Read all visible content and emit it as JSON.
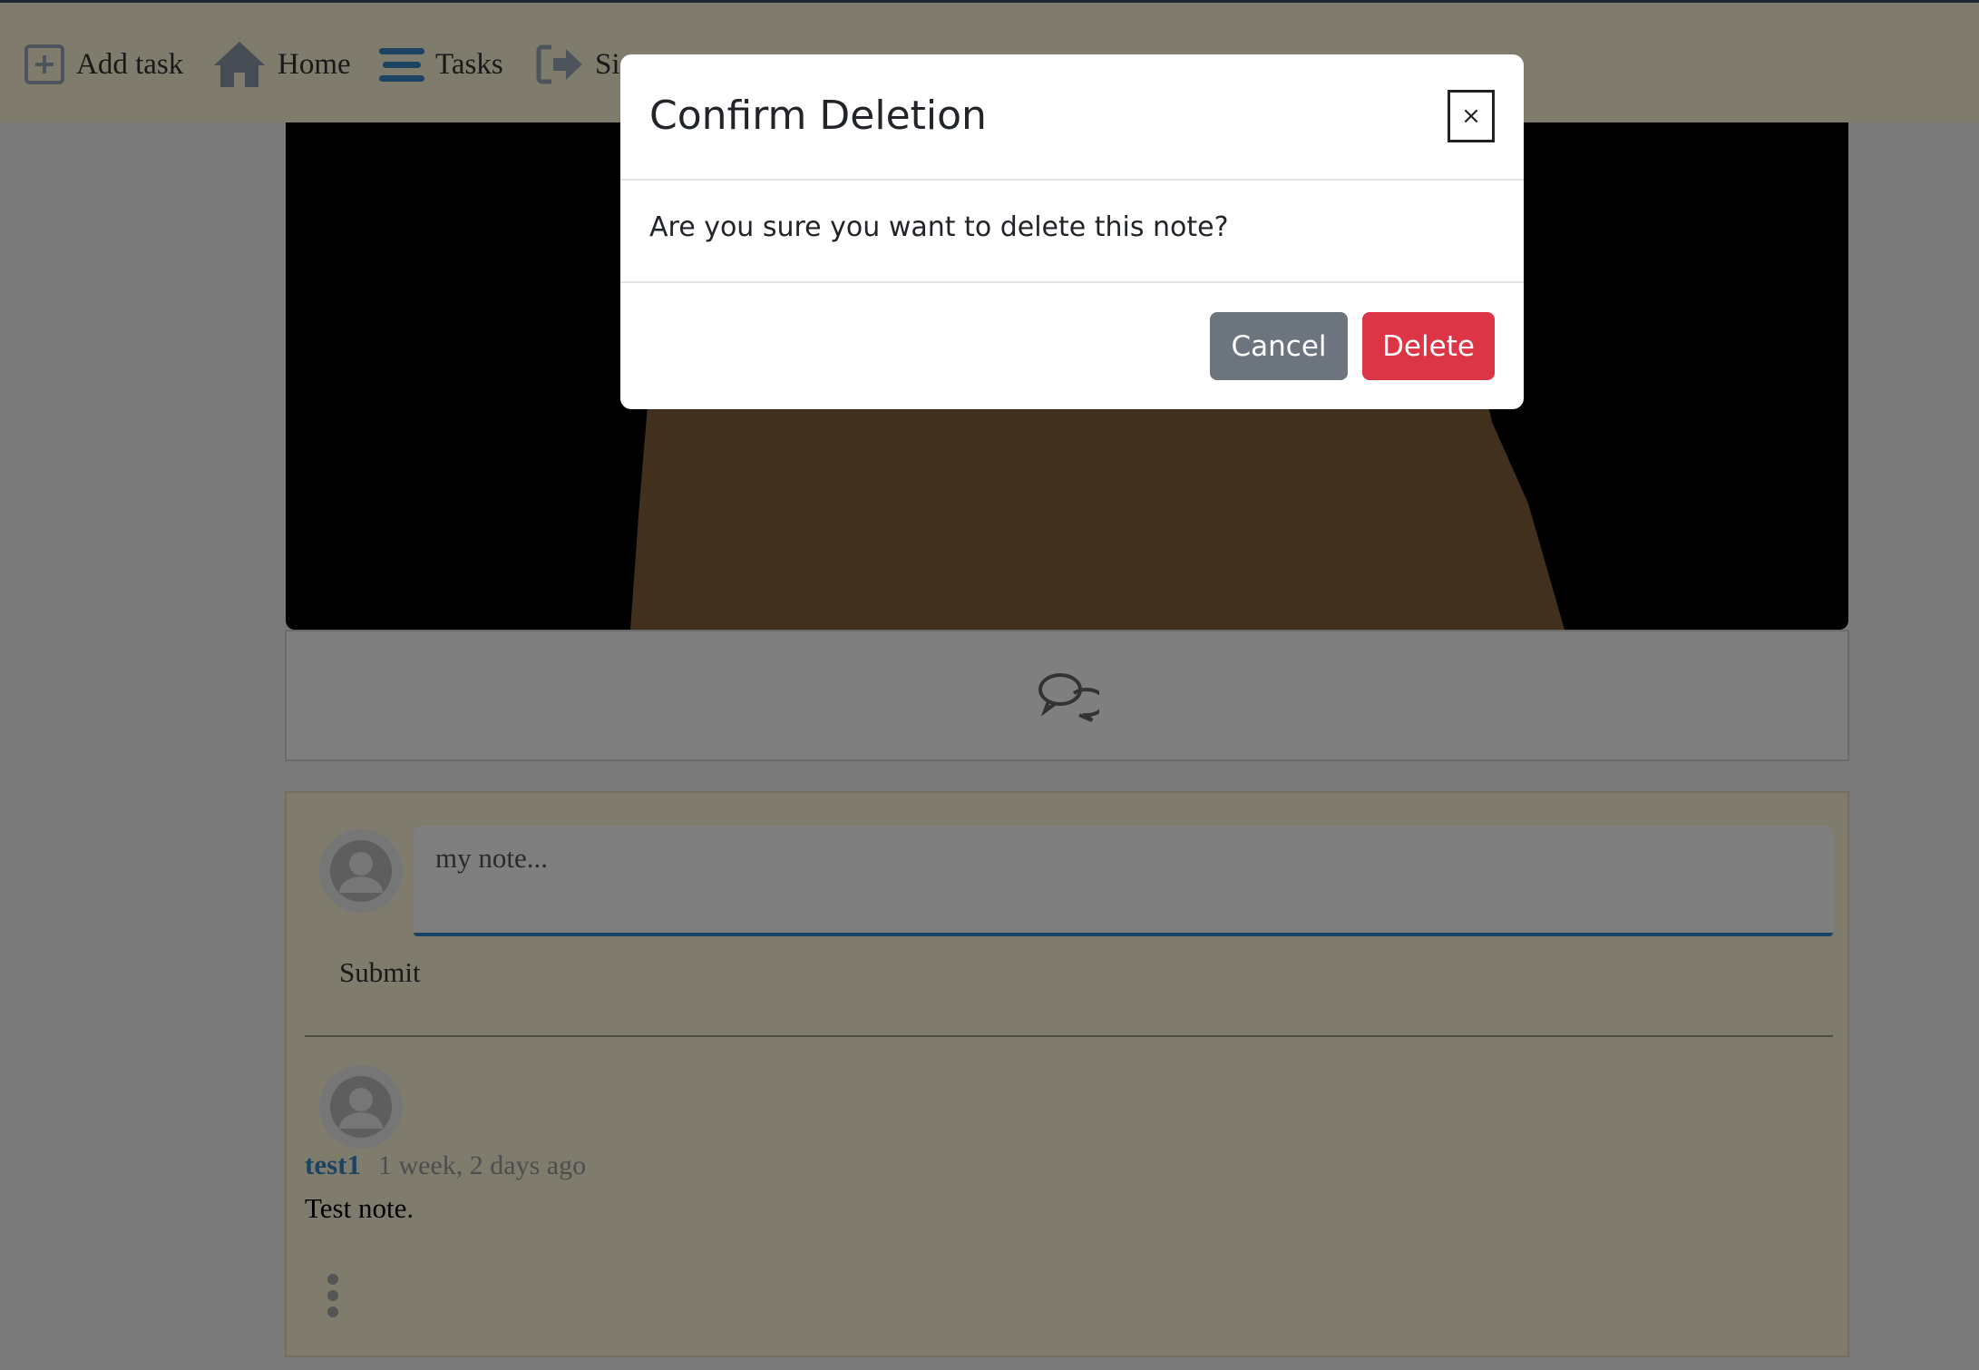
{
  "nav": {
    "items": [
      {
        "label": "Add task",
        "icon": "plus-square-icon"
      },
      {
        "label": "Home",
        "icon": "home-icon"
      },
      {
        "label": "Tasks",
        "icon": "list-icon"
      },
      {
        "label": "Sign out",
        "icon": "sign-out-icon"
      }
    ]
  },
  "comment_icon": "comments-icon",
  "note_form": {
    "placeholder": "my note...",
    "submit_label": "Submit"
  },
  "notes": [
    {
      "author": "test1",
      "time": "1 week, 2 days ago",
      "text": "Test note."
    }
  ],
  "modal": {
    "title": "Confirm Deletion",
    "close_label": "×",
    "body": "Are you sure you want to delete this note?",
    "cancel_label": "Cancel",
    "delete_label": "Delete"
  },
  "colors": {
    "nav_bg": "#fff9dc",
    "accent_blue": "#3a87c5",
    "cancel": "#6c757d",
    "delete": "#dc3545"
  }
}
